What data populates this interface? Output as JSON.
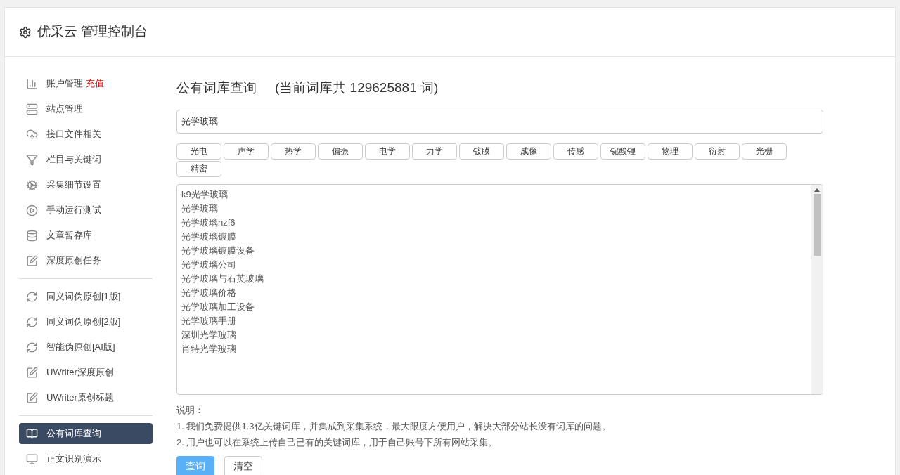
{
  "header": {
    "title": "优采云 管理控制台"
  },
  "sidebar": {
    "groups": [
      [
        {
          "label": "账户管理",
          "badge": "充值",
          "selected": false
        },
        {
          "label": "站点管理",
          "selected": false
        },
        {
          "label": "接口文件相关",
          "selected": false
        },
        {
          "label": "栏目与关键词",
          "selected": false
        },
        {
          "label": "采集细节设置",
          "selected": false
        },
        {
          "label": "手动运行测试",
          "selected": false
        },
        {
          "label": "文章暂存库",
          "selected": false
        },
        {
          "label": "深度原创任务",
          "selected": false
        }
      ],
      [
        {
          "label": "同义词伪原创[1版]",
          "selected": false
        },
        {
          "label": "同义词伪原创[2版]",
          "selected": false
        },
        {
          "label": "智能伪原创[AI版]",
          "selected": false
        },
        {
          "label": "UWriter深度原创",
          "selected": false
        },
        {
          "label": "UWriter原创标题",
          "selected": false
        }
      ],
      [
        {
          "label": "公有词库查询",
          "selected": true
        },
        {
          "label": "正文识别演示",
          "selected": false
        }
      ]
    ]
  },
  "main": {
    "title": "公有词库查询",
    "subtitle": "(当前词库共 129625881 词)",
    "search": {
      "value": "光学玻璃"
    },
    "tags": [
      "光电",
      "声学",
      "热学",
      "偏振",
      "电学",
      "力学",
      "镀膜",
      "成像",
      "传感",
      "铌酸锂",
      "物理",
      "衍射",
      "光栅",
      "精密"
    ],
    "results": [
      "k9光学玻璃",
      "光学玻璃",
      "光学玻璃hzf6",
      "光学玻璃镀膜",
      "光学玻璃镀膜设备",
      "光学玻璃公司",
      "光学玻璃与石英玻璃",
      "光学玻璃价格",
      "光学玻璃加工设备",
      "光学玻璃手册",
      "深圳光学玻璃",
      "肖特光学玻璃"
    ],
    "notes_title": "说明：",
    "notes": [
      "1. 我们免费提供1.3亿关键词库，并集成到采集系统，最大限度方便用户，解决大部分站长没有词库的问题。",
      "2. 用户也可以在系统上传自己已有的关键词库，用于自己账号下所有网站采集。"
    ],
    "buttons": [
      {
        "label": "查询",
        "kind": "primary"
      },
      {
        "label": "清空",
        "kind": "default"
      }
    ]
  }
}
